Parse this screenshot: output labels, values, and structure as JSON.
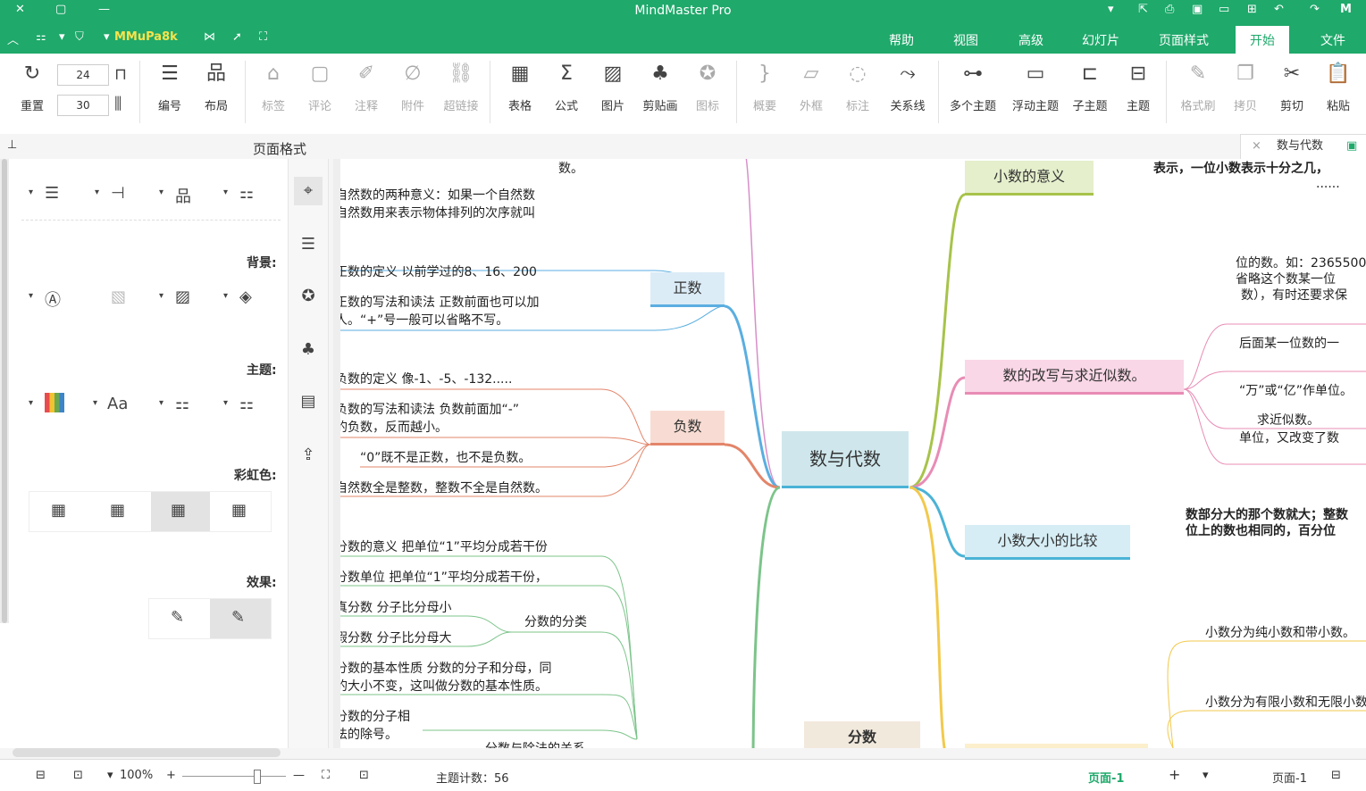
{
  "app": {
    "title": "MindMaster Pro"
  },
  "menu": {
    "tabs": [
      "文件",
      "开始",
      "页面样式",
      "幻灯片",
      "高级",
      "视图",
      "帮助"
    ],
    "active": "开始",
    "account": "MMuPa8k"
  },
  "ribbon": {
    "paste": "粘贴",
    "cut": "剪切",
    "copy": "拷贝",
    "format_painter": "格式刷",
    "topic": "主题",
    "subtopic": "子主题",
    "floating": "浮动主题",
    "multi": "多个主题",
    "relation": "关系线",
    "callout": "标注",
    "boundary": "外框",
    "summary": "概要",
    "icon": "图标",
    "clipart": "剪贴画",
    "picture": "图片",
    "formula": "公式",
    "table": "表格",
    "hyperlink": "超链接",
    "attachment": "附件",
    "note": "注释",
    "comment": "评论",
    "tag": "标签",
    "layout": "布局",
    "numbering": "编号",
    "reset": "重置",
    "spin_top": "24",
    "spin_bottom": "30"
  },
  "doc_tab": {
    "name": "数与代数",
    "close": "×"
  },
  "panel": {
    "title": "页面格式",
    "background": "背景:",
    "theme": "主题:",
    "rainbow": "彩虹色:",
    "effect": "效果:"
  },
  "map": {
    "central": "数与代数",
    "positive": "正数",
    "negative": "负数",
    "fraction_class": "分数的分类",
    "decimal_meaning": "小数的意义",
    "rewrite": "数的改写与求近似数。",
    "compare": "小数大小的比较",
    "fraction_node": "分数",
    "left_texts": [
      "数。",
      "自然数的两种意义：如果一个自然数",
      "自然数用来表示物体排列的次序就叫",
      "正数的定义   以前学过的8、16、200",
      "正数的写法和读法   正数前面也可以加",
      "人。“+”号一般可以省略不写。",
      "负数的定义  像-1、-5、-132.....",
      "负数的写法和读法  负数前面加“-”",
      "的负数，反而越小。",
      "“0”既不是正数，也不是负数。",
      "自然数全是整数，整数不全是自然数。",
      "分数的意义   把单位“1”平均分成若干份",
      "分数单位   把单位“1”平均分成若干份，",
      "真分数   分子比分母小",
      "假分数   分子比分母大",
      "分数的基本性质  分数的分子和分母，同",
      "的大小不变，这叫做分数的基本性质。",
      "分数的分子相",
      "法的除号。",
      "分数与除法的关系"
    ],
    "right_texts": [
      "表示，一位小数表示十分之几，",
      "......",
      "位的数。如：2365500",
      "省略这个数某一位",
      "数），有时还要求保",
      "后面某一位数的一",
      "“万”或“亿”作单位。",
      "求近似数。",
      "单位，又改变了数",
      "数部分大的那个数就大；整数",
      "位上的数也相同的，百分位",
      "小数分为纯小数和带小数。",
      "小数分为有限小数和无限小数。"
    ]
  },
  "status": {
    "page_label": "页面-1",
    "page_tab": "页面-1",
    "add": "+",
    "topic_count": "主题计数：56",
    "zoom": "100%"
  }
}
